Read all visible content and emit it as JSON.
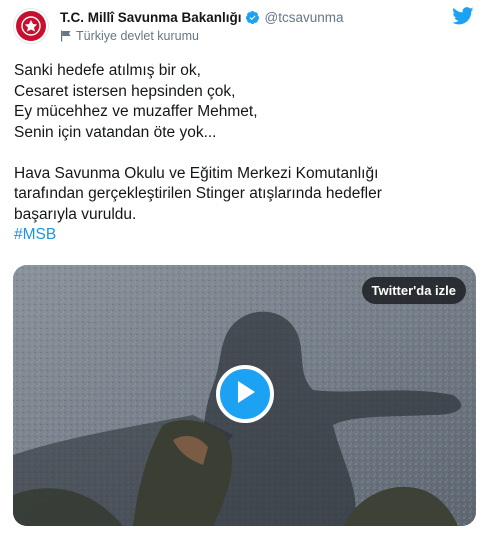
{
  "account": {
    "display_name": "T.C. Millî Savunma Bakanlığı",
    "handle": "@tcsavunma",
    "label": "Türkiye devlet kurumu",
    "avatar_icon": "ministry-emblem-icon",
    "brand_color": "#c8102e"
  },
  "tweet": {
    "lines": [
      "Sanki hedefe atılmış bir ok,",
      "Cesaret istersen hepsinden çok,",
      "Ey mücehhez ve muzaffer Mehmet,",
      "Senin için vatandan öte yok...",
      "",
      "Hava Savunma Okulu ve Eğitim Merkezi Komutanlığı",
      "tarafından gerçekleştirilen Stinger atışlarında hedefler",
      "başarıyla vuruldu."
    ],
    "hashtag": "#MSB"
  },
  "media": {
    "watch_label": "Twitter'da izle",
    "play_icon": "play-icon"
  },
  "colors": {
    "twitter_blue": "#1da1f2",
    "link": "#1b95e0",
    "secondary_text": "#657786"
  }
}
